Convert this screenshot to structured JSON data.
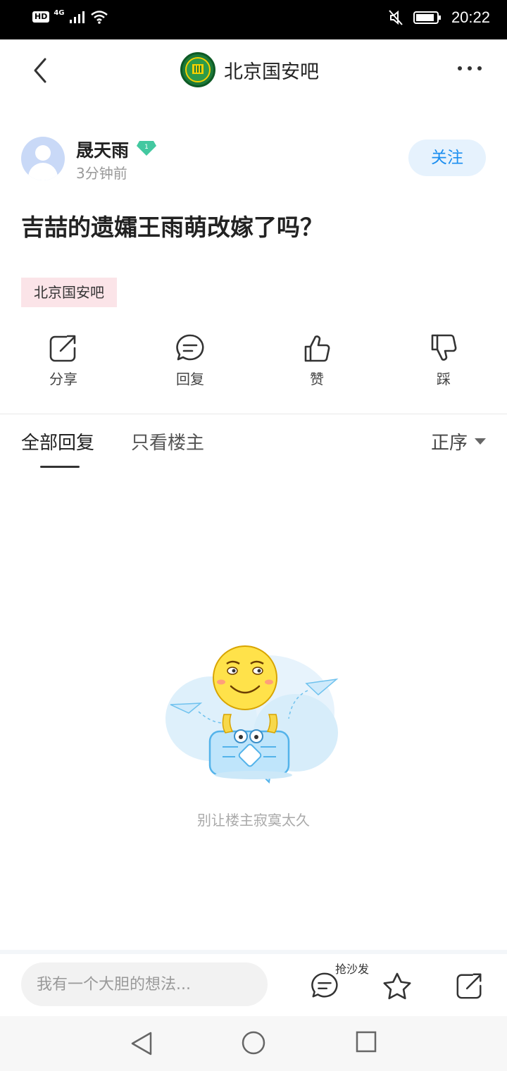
{
  "status_bar": {
    "hd": "HD",
    "network": "4G",
    "time": "20:22"
  },
  "header": {
    "forum_name": "北京国安吧"
  },
  "post": {
    "author": "晟天雨",
    "level": "1",
    "time": "3分钟前",
    "follow_label": "关注",
    "title": "吉喆的遗孀王雨萌改嫁了吗？",
    "tag": "北京国安吧"
  },
  "actions": [
    {
      "label": "分享",
      "icon": "share-icon"
    },
    {
      "label": "回复",
      "icon": "comment-icon"
    },
    {
      "label": "赞",
      "icon": "thumbs-up-icon"
    },
    {
      "label": "踩",
      "icon": "thumbs-down-icon"
    }
  ],
  "tabs": {
    "all": "全部回复",
    "op_only": "只看楼主",
    "sort": "正序"
  },
  "empty_state": {
    "text": "别让楼主寂寞太久"
  },
  "bottom_bar": {
    "placeholder": "我有一个大胆的想法...",
    "sofa_label": "抢沙发"
  },
  "colors": {
    "accent": "#1c8ff0",
    "follow_bg": "#e6f2fd",
    "tag_bg": "#fbe4e8",
    "level_badge": "#43c8a0"
  }
}
